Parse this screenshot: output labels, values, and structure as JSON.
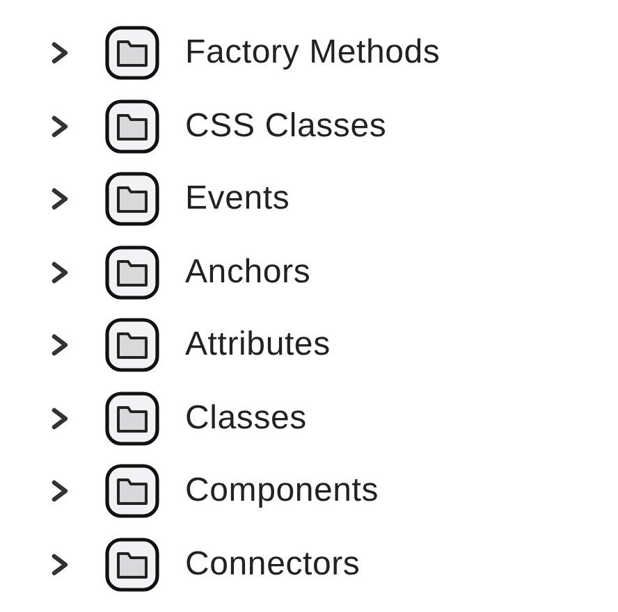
{
  "tree": [
    {
      "label": "Factory Methods",
      "expanded": false
    },
    {
      "label": "CSS Classes",
      "expanded": false
    },
    {
      "label": "Events",
      "expanded": false
    },
    {
      "label": "Anchors",
      "expanded": false
    },
    {
      "label": "Attributes",
      "expanded": false
    },
    {
      "label": "Classes",
      "expanded": false
    },
    {
      "label": "Components",
      "expanded": false
    },
    {
      "label": "Connectors",
      "expanded": false
    }
  ]
}
